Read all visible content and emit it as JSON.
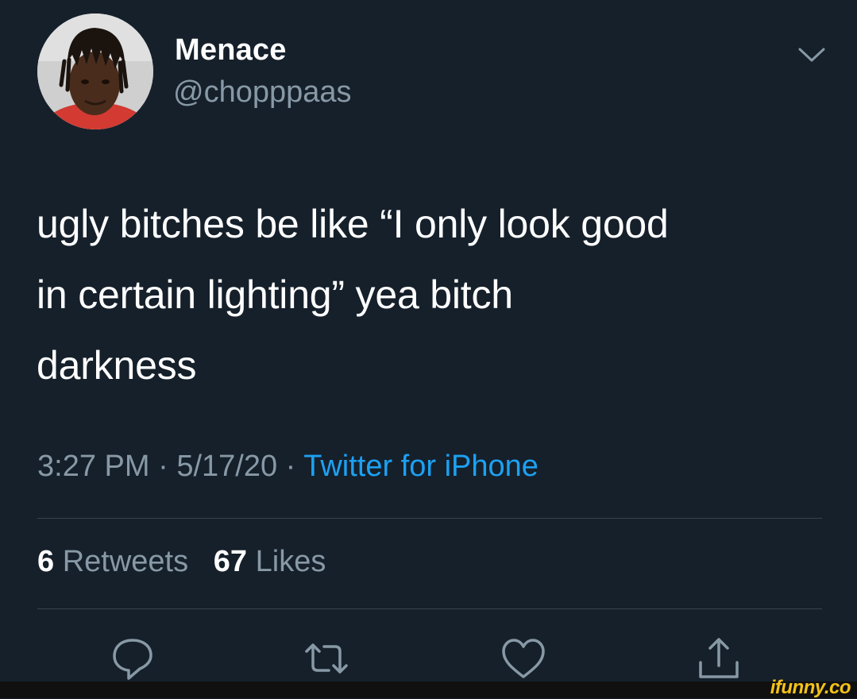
{
  "user": {
    "display_name": "Menace",
    "handle": "@chopppaas"
  },
  "tweet": {
    "lines": [
      "ugly bitches be like “I only look good",
      "in certain lighting” yea bitch",
      "darkness"
    ],
    "time": "3:27 PM",
    "separator": " · ",
    "date": "5/17/20",
    "source": "Twitter for iPhone"
  },
  "stats": {
    "retweets_count": "6",
    "retweets_label": "Retweets",
    "likes_count": "67",
    "likes_label": "Likes"
  },
  "actions": {
    "icons": [
      "reply-icon",
      "retweet-icon",
      "like-icon",
      "share-icon"
    ]
  },
  "watermark": "ifunny.co",
  "colors": {
    "background": "#15202b",
    "secondary_text": "#8899a6",
    "link": "#1da1f2",
    "divider": "#38444d"
  }
}
